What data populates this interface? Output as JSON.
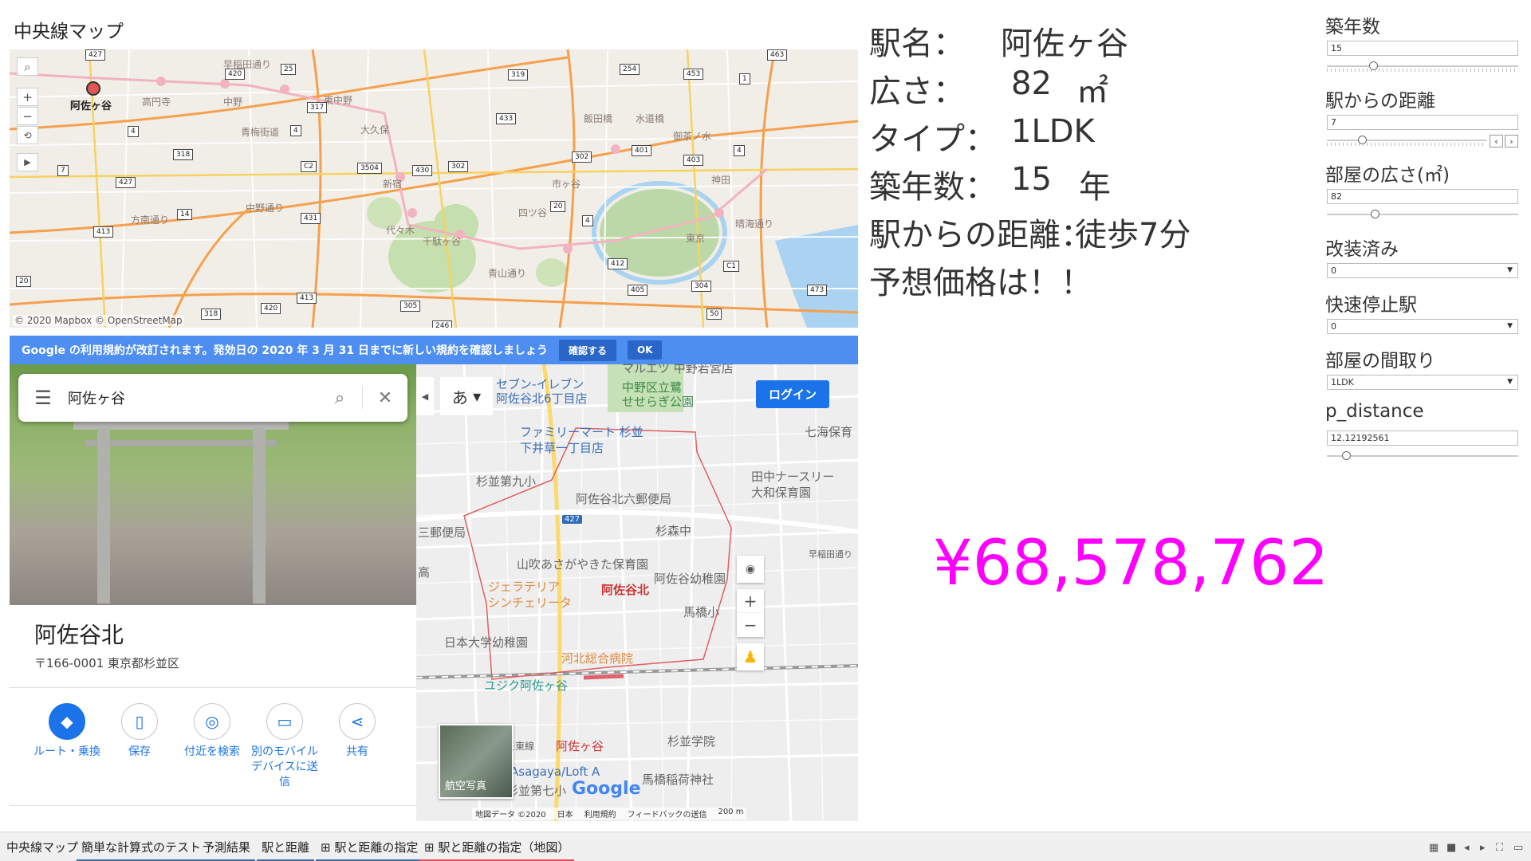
{
  "map": {
    "title": "中央線マップ",
    "station_label": "阿佐ヶ谷",
    "copyright": "© 2020 Mapbox © OpenStreetMap",
    "controls": [
      "search-icon",
      "zoom-in-icon",
      "zoom-out-icon",
      "reset-icon",
      "play-icon"
    ],
    "places": [
      "高円寺",
      "中野",
      "東中野",
      "大久保",
      "新宿",
      "代々木",
      "千駄ヶ谷",
      "四ツ谷",
      "市ヶ谷",
      "飯田橋",
      "水道橋",
      "御茶ノ水",
      "神田",
      "東京",
      "方南通り",
      "青梅街道",
      "早稲田通り",
      "中野通り",
      "青山通り",
      "晴海通り"
    ],
    "shields": [
      "427",
      "420",
      "25",
      "4",
      "318",
      "7",
      "427",
      "413",
      "14",
      "20",
      "318",
      "317",
      "4",
      "C2",
      "3504",
      "430",
      "302",
      "401",
      "403",
      "1",
      "319",
      "433",
      "254",
      "453",
      "463",
      "4",
      "302",
      "20",
      "4",
      "412",
      "405",
      "304",
      "C1",
      "473",
      "50",
      "305",
      "246",
      "420",
      "413",
      "431"
    ]
  },
  "google": {
    "banner_text": "Google の利用規約が改訂されます。発効日の 2020 年 3 月 31 日までに新しい規約を確認しましょう",
    "banner_confirm": "確認する",
    "banner_ok": "OK",
    "search_value": "阿佐ヶ谷",
    "place_name": "阿佐谷北",
    "place_address": "〒166-0001 東京都杉並区",
    "actions": [
      {
        "label": "ルート・乗換",
        "icon": "directions-icon"
      },
      {
        "label": "保存",
        "icon": "bookmark-icon"
      },
      {
        "label": "付近を検索",
        "icon": "nearby-icon"
      },
      {
        "label": "別のモバイル デバイスに送信",
        "icon": "send-to-device-icon"
      },
      {
        "label": "共有",
        "icon": "share-icon"
      }
    ],
    "ime": "あ",
    "login": "ログイン",
    "aerial": "航空写真",
    "footer": [
      "地図データ ©2020",
      "日本",
      "利用規約",
      "フィードバックの送信",
      "200 m"
    ],
    "labels": {
      "l1": "マルエツ 中野若宮店",
      "l2": "セブン-イレブン",
      "l3": "阿佐谷北6丁目店",
      "l4": "中野区立鷺",
      "l5": "せせらぎ公園",
      "l6": "ファミリーマート 杉並",
      "l7": "下井草一丁目店",
      "l8": "七海保育",
      "l9": "杉並第九小",
      "l10": "田中ナースリー",
      "l11": "大和保育園",
      "l12": "阿佐谷北六郵便局",
      "l13": "三郵便局",
      "l14": "杉森中",
      "l15": "山吹あさがやきた保育園",
      "l16": "阿佐谷幼稚園",
      "l17": "ジェラテリア",
      "l18": "シンチェリータ",
      "l19": "阿佐谷北",
      "l20": "馬橋小",
      "l21": "日本大学幼稚園",
      "l22": "河北総合病院",
      "l23": "ユジク阿佐ヶ谷",
      "l24": "中央東線",
      "l25": "阿佐ヶ谷",
      "l26": "杉並学院",
      "l27": "Asagaya/Loft A",
      "l28": "杉並第七小",
      "l29": "馬橋稲荷神社",
      "l30": "Google",
      "l31": "早稲田通り",
      "l32": "高",
      "l33": "427"
    }
  },
  "info": {
    "station_key": "駅名：",
    "station_val": "阿佐ヶ谷",
    "area_key": "広さ：",
    "area_val": "82",
    "area_unit": "㎡",
    "type_key": "タイプ：",
    "type_val": "1LDK",
    "age_key": "築年数：",
    "age_val": "15",
    "age_unit": "年",
    "dist_key": "駅からの距離：",
    "dist_val": "徒歩7分",
    "predict": "予想価格は！！"
  },
  "price": "¥68,578,762",
  "params": [
    {
      "label": "築年数",
      "value": "15",
      "kind": "slider",
      "fraction": 0.24
    },
    {
      "label": "駅からの距離",
      "value": "7",
      "kind": "slider-stepper",
      "fraction": 0.22
    },
    {
      "label": "部屋の広さ(㎡)",
      "value": "82",
      "kind": "slider",
      "fraction": 0.25
    },
    {
      "label": "改装済み",
      "value": "0",
      "kind": "select"
    },
    {
      "label": "快速停止駅",
      "value": "0",
      "kind": "select"
    },
    {
      "label": "部屋の間取り",
      "value": "1LDK",
      "kind": "select"
    },
    {
      "label": "p_distance",
      "value": "12.12192561",
      "kind": "slider",
      "fraction": 0.1
    }
  ],
  "tabs": [
    {
      "label": "中央線マップ",
      "active": false
    },
    {
      "label": "簡単な計算式のテスト",
      "active": false
    },
    {
      "label": "予測結果",
      "active": false
    },
    {
      "label": "駅と距離",
      "active": false
    },
    {
      "label": "⊞ 駅と距離の指定",
      "active": false
    },
    {
      "label": "⊞ 駅と距離の指定（地図）",
      "active": true
    }
  ],
  "colors": {
    "price": "#ff00ff",
    "banner": "#4d8ef0",
    "google_blue": "#1a73e8",
    "station_marker": "#e05555"
  }
}
